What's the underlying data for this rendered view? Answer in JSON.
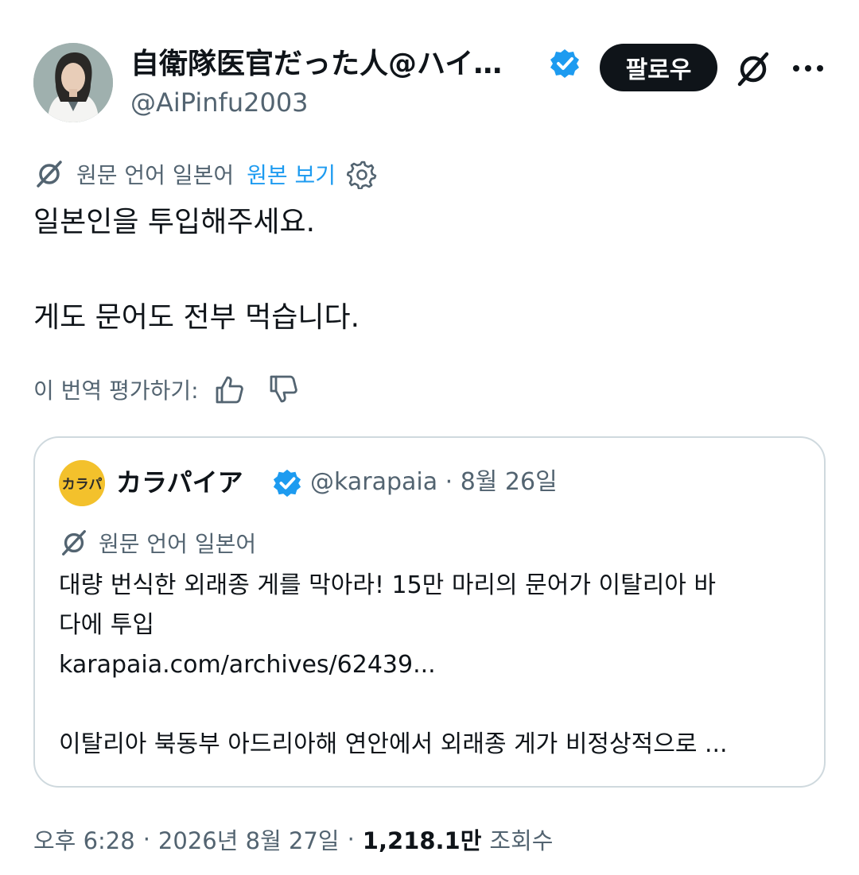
{
  "author": {
    "display_name": "自衛隊医官だった人@ハイラ…",
    "handle": "@AiPinfu2003",
    "verified_color": "#1d9bf0"
  },
  "header": {
    "follow_label": "팔로우"
  },
  "translation": {
    "source_label": "원문 언어 일본어",
    "view_original": "원본 보기"
  },
  "post": {
    "line1": "일본인을 투입해주세요.",
    "line2": "게도 문어도 전부 먹습니다."
  },
  "rating": {
    "label": "이 번역 평가하기:"
  },
  "quote": {
    "avatar_text": "カラパイア",
    "name": "カラパイア",
    "handle_date": "@karapaia · 8월 26일",
    "source_label": "원문 언어 일본어",
    "text_line1": "대량 번식한 외래종 게를 막아라! 15만 마리의 문어가 이탈리아 바",
    "text_line2": "다에 투입",
    "link": "karapaia.com/archives/62439...",
    "text_line3": "이탈리아 북동부 아드리아해 연안에서 외래종 게가 비정상적으로 ..."
  },
  "footer": {
    "time": "오후 6:28",
    "date": "2026년 8월 27일",
    "views_count": "1,218.1만",
    "views_label": "조회수"
  },
  "colors": {
    "accent": "#1d9bf0",
    "muted": "#536471",
    "border": "#cfd9de",
    "quote_avatar": "#f3c12c"
  }
}
